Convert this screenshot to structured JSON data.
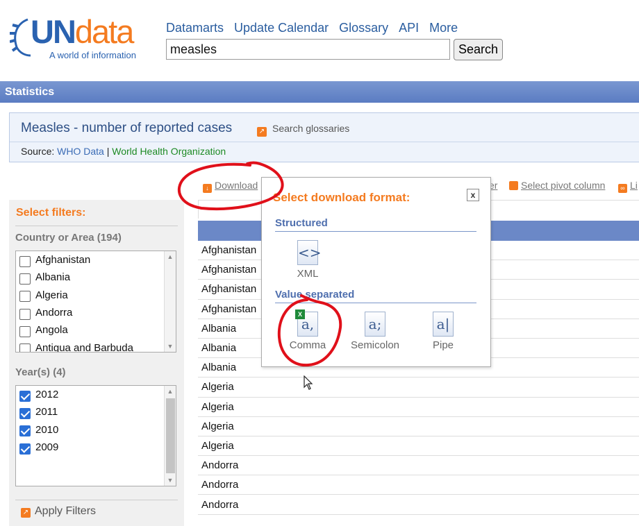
{
  "logo": {
    "un": "UN",
    "data": "data",
    "tagline": "A world of information"
  },
  "nav": [
    "Datamarts",
    "Update Calendar",
    "Glossary",
    "API",
    "More"
  ],
  "search": {
    "value": "measles",
    "button": "Search"
  },
  "statbar": "Statistics",
  "dataset": {
    "title": "Measles - number of reported cases",
    "glossaries": "Search glossaries",
    "source_label": "Source:",
    "source_link1": "WHO Data",
    "source_sep": "|",
    "source_link2": "World Health Organization"
  },
  "toolbar": {
    "download": "Download",
    "filter_suffix": "er",
    "pivot": "Select pivot column",
    "li": "Li"
  },
  "filters": {
    "title": "Select filters:",
    "country_label": "Country or Area (194)",
    "countries": [
      "Afghanistan",
      "Albania",
      "Algeria",
      "Andorra",
      "Angola",
      "Antigua and Barbuda"
    ],
    "year_label": "Year(s) (4)",
    "years": [
      "2012",
      "2011",
      "2010",
      "2009"
    ],
    "apply": "Apply Filters"
  },
  "table_rows": [
    "Afghanistan",
    "Afghanistan",
    "Afghanistan",
    "Afghanistan",
    "Albania",
    "Albania",
    "Albania",
    "Algeria",
    "Algeria",
    "Algeria",
    "Algeria",
    "Andorra",
    "Andorra",
    "Andorra"
  ],
  "popup": {
    "title": "Select download format:",
    "close": "x",
    "structured": "Structured",
    "xml": "XML",
    "value_separated": "Value separated",
    "comma": "Comma",
    "semicolon": "Semicolon",
    "pipe": "Pipe"
  },
  "colors": {
    "accent": "#f47b20",
    "brand_blue": "#2a62b0",
    "bar": "#6b88c7",
    "annotation": "#e0101a"
  }
}
